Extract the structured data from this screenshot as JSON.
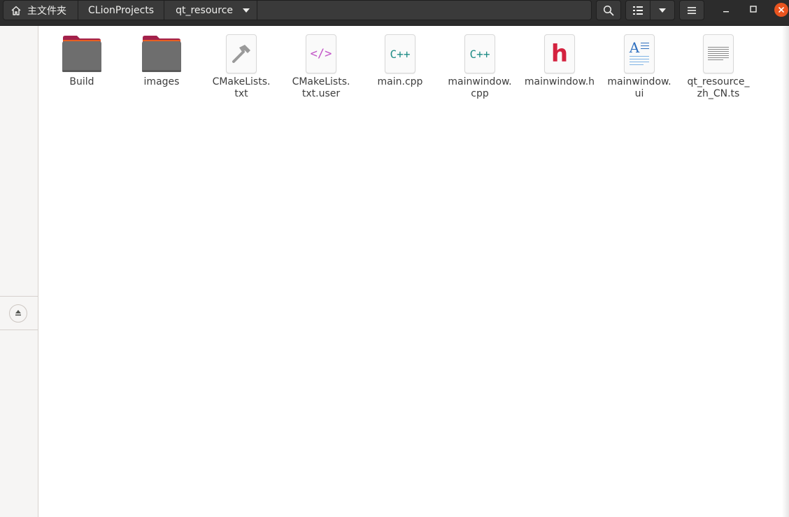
{
  "pathbar": {
    "crumbs": [
      "主文件夹",
      "CLionProjects",
      "qt_resource"
    ]
  },
  "icons": {
    "home": "home-icon",
    "dropdown": "chevron-down-icon",
    "search": "search-icon",
    "list_view": "list-view-icon",
    "menu": "hamburger-menu-icon",
    "minimize": "minimize-icon",
    "maximize": "maximize-icon",
    "close": "close-icon",
    "eject": "eject-icon"
  },
  "colors": {
    "headerbar": "#2c2c2c",
    "close_button": "#e9541f",
    "folder_body": "#6e6e6e",
    "folder_tab": "#a3214b",
    "cpp_glyph": "#1f8c86",
    "header_glyph": "#d4223f",
    "xml_glyph": "#c254c7",
    "ui_glyph": "#2e6fbf"
  },
  "files": [
    {
      "name": "Build",
      "type": "folder"
    },
    {
      "name": "images",
      "type": "folder"
    },
    {
      "name": "CMakeLists.\ntxt",
      "type": "cmake"
    },
    {
      "name": "CMakeLists.\ntxt.user",
      "type": "xml",
      "glyph": "</>"
    },
    {
      "name": "main.cpp",
      "type": "cpp",
      "glyph": "C++"
    },
    {
      "name": "mainwindow.\ncpp",
      "type": "cpp",
      "glyph": "C++"
    },
    {
      "name": "mainwindow.h",
      "type": "header",
      "glyph": "h"
    },
    {
      "name": "mainwindow.\nui",
      "type": "ui",
      "glyph": "A"
    },
    {
      "name": "qt_resource_\nzh_CN.ts",
      "type": "text"
    }
  ]
}
